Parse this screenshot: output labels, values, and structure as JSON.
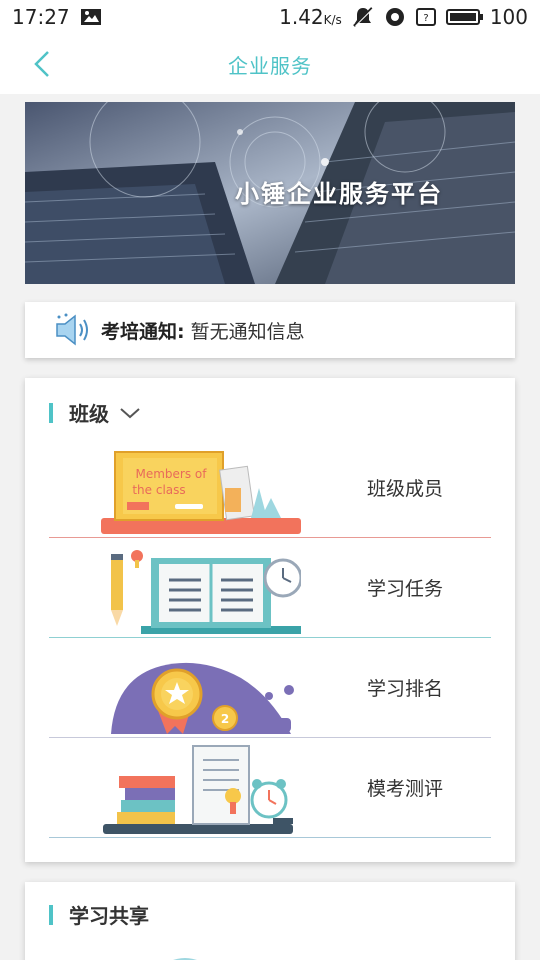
{
  "status": {
    "time": "17:27",
    "speed": "1.42",
    "speed_unit": "K/s",
    "battery": "100"
  },
  "nav": {
    "title": "企业服务"
  },
  "banner": {
    "title": "小锤企业服务平台"
  },
  "notice": {
    "label": "考培通知:",
    "text": "暂无通知信息"
  },
  "class_section": {
    "title": "班级",
    "items": [
      {
        "label": "班级成员",
        "illustration_text": "Members of the class",
        "line_color": "#e89a94"
      },
      {
        "label": "学习任务",
        "line_color": "#8fd0d2"
      },
      {
        "label": "学习排名",
        "line_color": "#c7c9da"
      },
      {
        "label": "模考测评",
        "line_color": "#a8c8d8"
      }
    ]
  },
  "share_section": {
    "title": "学习共享"
  },
  "colors": {
    "accent": "#4fc3c7",
    "nav_title": "#4fc3c7"
  }
}
